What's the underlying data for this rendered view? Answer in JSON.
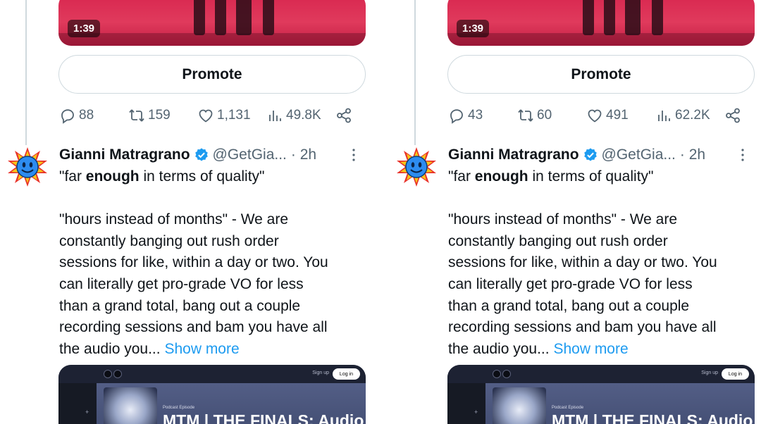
{
  "tweets": [
    {
      "video_duration": "1:39",
      "promote_label": "Promote",
      "stats": {
        "replies": "88",
        "retweets": "159",
        "likes": "1,131",
        "views": "49.8K"
      },
      "author": {
        "name": "Gianni Matragrano",
        "handle": "@GetGia...",
        "time": "· 2h"
      },
      "body": {
        "line1_pre": "\"far ",
        "line1_bold": "enough",
        "line1_post": " in terms of quality\"",
        "line2": "\"hours instead of months\" - We are",
        "line3": "constantly banging out rush order",
        "line4": "sessions for like, within a day or two. You",
        "line5": "can literally get pro-grade VO for less",
        "line6": "than a grand total, bang out a couple",
        "line7": "recording sessions and bam you have all",
        "line8": "the audio you...",
        "show_more": "Show more"
      },
      "card": {
        "signup": "Sign up",
        "login": "Log in",
        "label": "Podcast Episode",
        "title": "MTM | THE FINALS: Audio",
        "plus": "+"
      }
    },
    {
      "video_duration": "1:39",
      "promote_label": "Promote",
      "stats": {
        "replies": "43",
        "retweets": "60",
        "likes": "491",
        "views": "62.2K"
      },
      "author": {
        "name": "Gianni Matragrano",
        "handle": "@GetGia...",
        "time": "· 2h"
      },
      "body": {
        "line1_pre": "\"far ",
        "line1_bold": "enough",
        "line1_post": " in terms of quality\"",
        "line2": "\"hours instead of months\" - We are",
        "line3": "constantly banging out rush order",
        "line4": "sessions for like, within a day or two. You",
        "line5": "can literally get pro-grade VO for less",
        "line6": "than a grand total, bang out a couple",
        "line7": "recording sessions and bam you have all",
        "line8": "the audio you...",
        "show_more": "Show more"
      },
      "card": {
        "signup": "Sign up",
        "login": "Log in",
        "label": "Podcast Episode",
        "title": "MTM | THE FINALS: Audio",
        "plus": "+"
      }
    }
  ],
  "colors": {
    "link": "#1d9bf0",
    "muted": "#536471",
    "text": "#0f1419",
    "verified": "#1d9bf0"
  },
  "icons": [
    "reply-icon",
    "retweet-icon",
    "like-icon",
    "views-icon",
    "share-icon",
    "verified-badge-icon",
    "more-options-icon"
  ]
}
